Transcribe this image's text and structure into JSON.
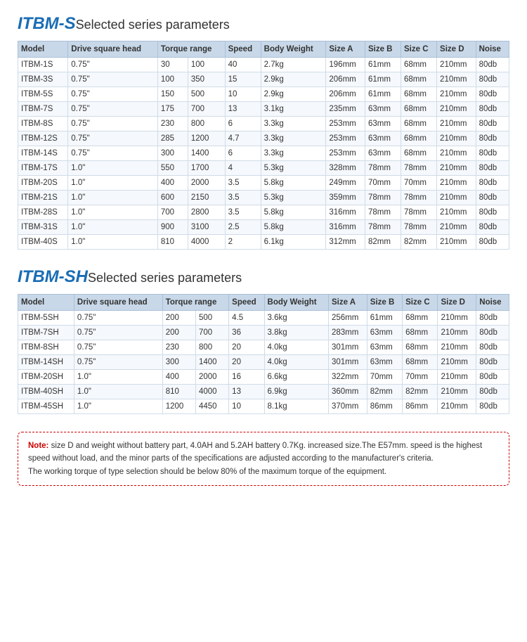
{
  "section1": {
    "title_brand": "ITBM-S",
    "title_desc": "Selected series parameters",
    "headers": [
      "Model",
      "Drive square head",
      "Torque range",
      "",
      "Speed",
      "Body Weight",
      "Size A",
      "Size B",
      "Size C",
      "Size D",
      "Noise"
    ],
    "columns": [
      "Model",
      "Drive square head",
      "Torque range min",
      "Torque range max",
      "Speed",
      "Body Weight",
      "Size A",
      "Size B",
      "Size C",
      "Size D",
      "Noise"
    ],
    "rows": [
      [
        "ITBM-1S",
        "0.75\"",
        "30",
        "100",
        "40",
        "2.7kg",
        "196mm",
        "61mm",
        "68mm",
        "210mm",
        "80db"
      ],
      [
        "ITBM-3S",
        "0.75\"",
        "100",
        "350",
        "15",
        "2.9kg",
        "206mm",
        "61mm",
        "68mm",
        "210mm",
        "80db"
      ],
      [
        "ITBM-5S",
        "0.75\"",
        "150",
        "500",
        "10",
        "2.9kg",
        "206mm",
        "61mm",
        "68mm",
        "210mm",
        "80db"
      ],
      [
        "ITBM-7S",
        "0.75\"",
        "175",
        "700",
        "13",
        "3.1kg",
        "235mm",
        "63mm",
        "68mm",
        "210mm",
        "80db"
      ],
      [
        "ITBM-8S",
        "0.75\"",
        "230",
        "800",
        "6",
        "3.3kg",
        "253mm",
        "63mm",
        "68mm",
        "210mm",
        "80db"
      ],
      [
        "ITBM-12S",
        "0.75\"",
        "285",
        "1200",
        "4.7",
        "3.3kg",
        "253mm",
        "63mm",
        "68mm",
        "210mm",
        "80db"
      ],
      [
        "ITBM-14S",
        "0.75\"",
        "300",
        "1400",
        "6",
        "3.3kg",
        "253mm",
        "63mm",
        "68mm",
        "210mm",
        "80db"
      ],
      [
        "ITBM-17S",
        "1.0\"",
        "550",
        "1700",
        "4",
        "5.3kg",
        "328mm",
        "78mm",
        "78mm",
        "210mm",
        "80db"
      ],
      [
        "ITBM-20S",
        "1.0\"",
        "400",
        "2000",
        "3.5",
        "5.8kg",
        "249mm",
        "70mm",
        "70mm",
        "210mm",
        "80db"
      ],
      [
        "ITBM-21S",
        "1.0\"",
        "600",
        "2150",
        "3.5",
        "5.3kg",
        "359mm",
        "78mm",
        "78mm",
        "210mm",
        "80db"
      ],
      [
        "ITBM-28S",
        "1.0\"",
        "700",
        "2800",
        "3.5",
        "5.8kg",
        "316mm",
        "78mm",
        "78mm",
        "210mm",
        "80db"
      ],
      [
        "ITBM-31S",
        "1.0\"",
        "900",
        "3100",
        "2.5",
        "5.8kg",
        "316mm",
        "78mm",
        "78mm",
        "210mm",
        "80db"
      ],
      [
        "ITBM-40S",
        "1.0\"",
        "810",
        "4000",
        "2",
        "6.1kg",
        "312mm",
        "82mm",
        "82mm",
        "210mm",
        "80db"
      ]
    ]
  },
  "section2": {
    "title_brand": "ITBM-SH",
    "title_desc": "Selected series parameters",
    "rows": [
      [
        "ITBM-5SH",
        "0.75\"",
        "200",
        "500",
        "4.5",
        "3.6kg",
        "256mm",
        "61mm",
        "68mm",
        "210mm",
        "80db"
      ],
      [
        "ITBM-7SH",
        "0.75\"",
        "200",
        "700",
        "36",
        "3.8kg",
        "283mm",
        "63mm",
        "68mm",
        "210mm",
        "80db"
      ],
      [
        "ITBM-8SH",
        "0.75\"",
        "230",
        "800",
        "20",
        "4.0kg",
        "301mm",
        "63mm",
        "68mm",
        "210mm",
        "80db"
      ],
      [
        "ITBM-14SH",
        "0.75\"",
        "300",
        "1400",
        "20",
        "4.0kg",
        "301mm",
        "63mm",
        "68mm",
        "210mm",
        "80db"
      ],
      [
        "ITBM-20SH",
        "1.0\"",
        "400",
        "2000",
        "16",
        "6.6kg",
        "322mm",
        "70mm",
        "70mm",
        "210mm",
        "80db"
      ],
      [
        "ITBM-40SH",
        "1.0\"",
        "810",
        "4000",
        "13",
        "6.9kg",
        "360mm",
        "82mm",
        "82mm",
        "210mm",
        "80db"
      ],
      [
        "ITBM-45SH",
        "1.0\"",
        "1200",
        "4450",
        "10",
        "8.1kg",
        "370mm",
        "86mm",
        "86mm",
        "210mm",
        "80db"
      ]
    ]
  },
  "note": {
    "label": "Note:",
    "text": " size D and weight without battery part, 4.0AH and 5.2AH battery 0.7Kg. increased size.The E57mm. speed is the highest speed without load, and the minor parts of the specifications are adjusted according to the manufacturer's criteria.",
    "text2": "The working torque of type selection should be below 80% of the maximum torque of the equipment."
  },
  "table_headers": {
    "model": "Model",
    "drive_square_head": "Drive square head",
    "torque_range": "Torque range",
    "speed": "Speed",
    "body_weight": "Body Weight",
    "size_a": "Size A",
    "size_b": "Size B",
    "size_c": "Size C",
    "size_d": "Size D",
    "noise": "Noise"
  }
}
